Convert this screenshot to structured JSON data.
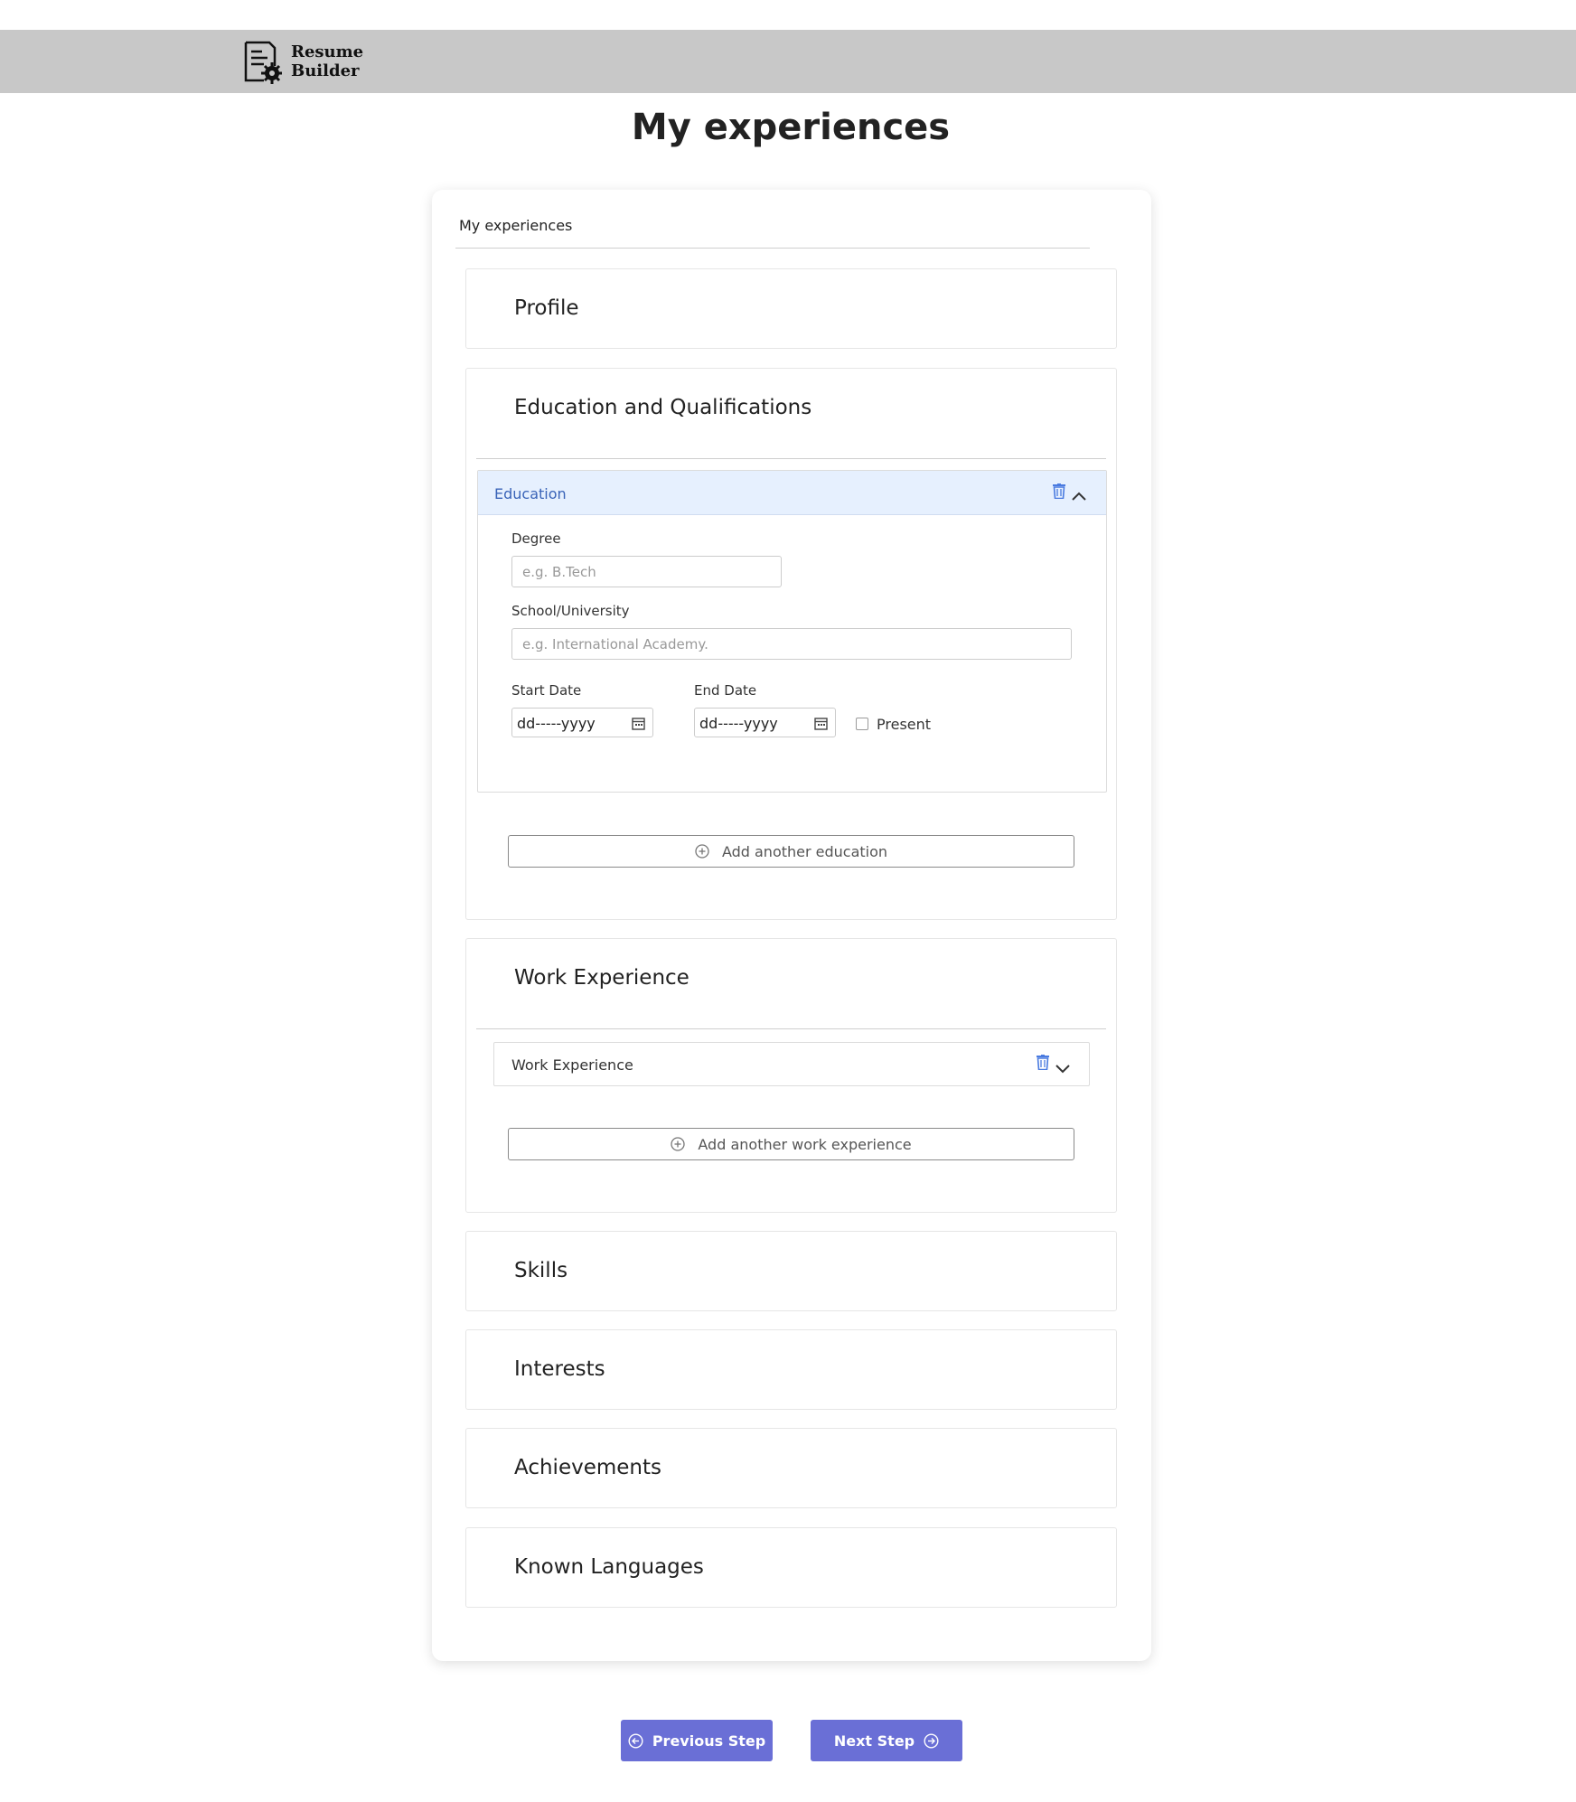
{
  "app": {
    "logo_line1": "Resume",
    "logo_line2": "Builder",
    "logo_icon": "resume-gear-icon"
  },
  "page": {
    "title": "My experiences"
  },
  "card": {
    "header": "My experiences"
  },
  "sections": {
    "profile": {
      "title": "Profile"
    },
    "education": {
      "title": "Education and Qualifications",
      "item": {
        "label": "Education",
        "expanded": true,
        "degree_label": "Degree",
        "degree_placeholder": "e.g. B.Tech",
        "school_label": "School/University",
        "school_placeholder": "e.g. International Academy.",
        "start_label": "Start Date",
        "start_value": "dd-----yyyy",
        "end_label": "End Date",
        "end_value": "dd-----yyyy",
        "present_label": "Present",
        "present_checked": false
      },
      "add_label": "Add another education"
    },
    "work": {
      "title": "Work Experience",
      "item": {
        "label": "Work Experience",
        "expanded": false
      },
      "add_label": "Add another work experience"
    },
    "skills": {
      "title": "Skills"
    },
    "interests": {
      "title": "Interests"
    },
    "achievements": {
      "title": "Achievements"
    },
    "languages": {
      "title": "Known Languages"
    }
  },
  "nav": {
    "previous_label": "Previous Step",
    "next_label": "Next Step"
  },
  "colors": {
    "accent": "#6a6fd6",
    "accordion_header_bg": "#e6f0fe",
    "accordion_header_text": "#3a64b8",
    "trash_icon": "#4a7be0",
    "topbar": "#c8c8c8"
  }
}
